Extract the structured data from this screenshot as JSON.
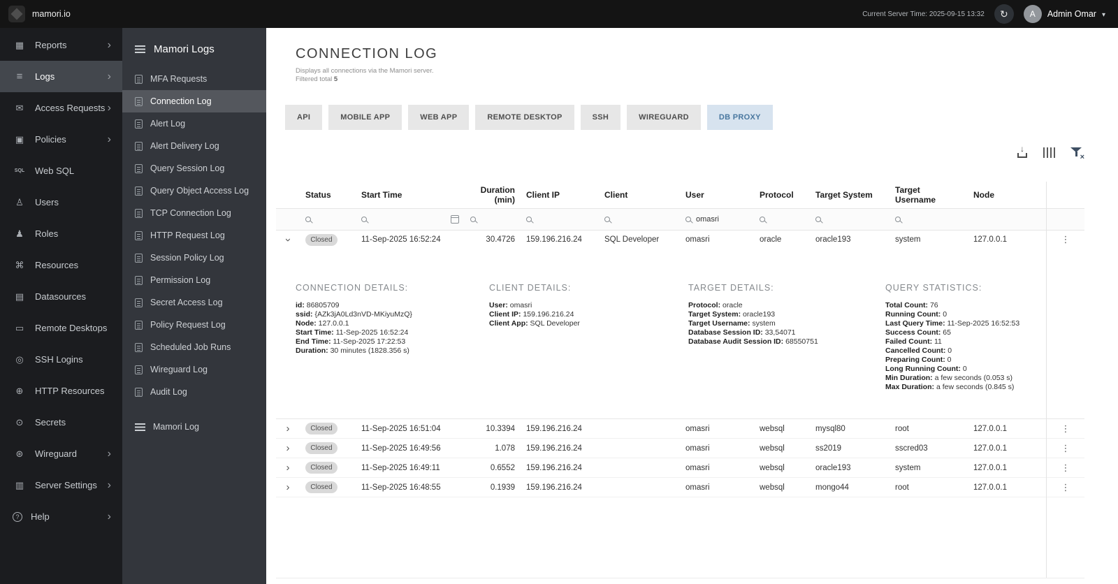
{
  "topbar": {
    "logo_text": "mamori.io",
    "server_time": "Current Server Time: 2025-09-15 13:32",
    "user_name": "Admin Omar",
    "avatar_letter": "A"
  },
  "sidebar": {
    "items": [
      {
        "label": "Reports",
        "icon": "reports-icon",
        "chevron": true,
        "active": false
      },
      {
        "label": "Logs",
        "icon": "logs-icon",
        "chevron": true,
        "active": true
      },
      {
        "label": "Access Requests",
        "icon": "access-requests-icon",
        "chevron": true,
        "active": false
      },
      {
        "label": "Policies",
        "icon": "policies-icon",
        "chevron": true,
        "active": false
      },
      {
        "label": "Web SQL",
        "icon": "web-sql-icon",
        "chevron": false,
        "active": false
      },
      {
        "label": "Users",
        "icon": "users-icon",
        "chevron": false,
        "active": false
      },
      {
        "label": "Roles",
        "icon": "roles-icon",
        "chevron": false,
        "active": false
      },
      {
        "label": "Resources",
        "icon": "resources-icon",
        "chevron": false,
        "active": false
      },
      {
        "label": "Datasources",
        "icon": "datasources-icon",
        "chevron": false,
        "active": false
      },
      {
        "label": "Remote Desktops",
        "icon": "remote-desktops-icon",
        "chevron": false,
        "active": false
      },
      {
        "label": "SSH Logins",
        "icon": "ssh-logins-icon",
        "chevron": false,
        "active": false
      },
      {
        "label": "HTTP Resources",
        "icon": "http-resources-icon",
        "chevron": false,
        "active": false
      },
      {
        "label": "Secrets",
        "icon": "secrets-icon",
        "chevron": false,
        "active": false
      },
      {
        "label": "Wireguard",
        "icon": "wireguard-icon",
        "chevron": true,
        "active": false
      },
      {
        "label": "Server Settings",
        "icon": "server-settings-icon",
        "chevron": true,
        "active": false
      },
      {
        "label": "Help",
        "icon": "help-icon",
        "chevron": true,
        "active": false
      }
    ]
  },
  "subsidebar": {
    "title": "Mamori Logs",
    "items": [
      {
        "label": "MFA Requests",
        "active": false
      },
      {
        "label": "Connection Log",
        "active": true
      },
      {
        "label": "Alert Log",
        "active": false
      },
      {
        "label": "Alert Delivery Log",
        "active": false
      },
      {
        "label": "Query Session Log",
        "active": false
      },
      {
        "label": "Query Object Access Log",
        "active": false
      },
      {
        "label": "TCP Connection Log",
        "active": false
      },
      {
        "label": "HTTP Request Log",
        "active": false
      },
      {
        "label": "Session Policy Log",
        "active": false
      },
      {
        "label": "Permission Log",
        "active": false
      },
      {
        "label": "Secret Access Log",
        "active": false
      },
      {
        "label": "Policy Request Log",
        "active": false
      },
      {
        "label": "Scheduled Job Runs",
        "active": false
      },
      {
        "label": "Wireguard Log",
        "active": false
      },
      {
        "label": "Audit Log",
        "active": false
      }
    ],
    "bottom_item": "Mamori Log"
  },
  "main": {
    "title": "CONNECTION LOG",
    "subtitle": "Displays all connections via the Mamori server.",
    "filtered_label": "Filtered total",
    "filtered_total": "5",
    "tabs": [
      {
        "label": "API",
        "active": false
      },
      {
        "label": "MOBILE APP",
        "active": false
      },
      {
        "label": "WEB APP",
        "active": false
      },
      {
        "label": "REMOTE DESKTOP",
        "active": false
      },
      {
        "label": "SSH",
        "active": false
      },
      {
        "label": "WIREGUARD",
        "active": false
      },
      {
        "label": "DB PROXY",
        "active": true
      }
    ],
    "table": {
      "columns": [
        "Status",
        "Start Time",
        "Duration (min)",
        "Client IP",
        "Client",
        "User",
        "Protocol",
        "Target System",
        "Target Username",
        "Node"
      ],
      "filters": {
        "user": "omasri"
      },
      "expanded_row": {
        "status": "Closed",
        "start_time": "11-Sep-2025 16:52:24",
        "duration": "30.4726",
        "client_ip": "159.196.216.24",
        "client": "SQL Developer",
        "user": "omasri",
        "protocol": "oracle",
        "target_system": "oracle193",
        "target_username": "system",
        "node": "127.0.0.1"
      },
      "rows": [
        {
          "status": "Closed",
          "start_time": "11-Sep-2025 16:51:04",
          "duration": "10.3394",
          "client_ip": "159.196.216.24",
          "client": "",
          "user": "omasri",
          "protocol": "websql",
          "target_system": "mysql80",
          "target_username": "root",
          "node": "127.0.0.1"
        },
        {
          "status": "Closed",
          "start_time": "11-Sep-2025 16:49:56",
          "duration": "1.078",
          "client_ip": "159.196.216.24",
          "client": "",
          "user": "omasri",
          "protocol": "websql",
          "target_system": "ss2019",
          "target_username": "sscred03",
          "node": "127.0.0.1"
        },
        {
          "status": "Closed",
          "start_time": "11-Sep-2025 16:49:11",
          "duration": "0.6552",
          "client_ip": "159.196.216.24",
          "client": "",
          "user": "omasri",
          "protocol": "websql",
          "target_system": "oracle193",
          "target_username": "system",
          "node": "127.0.0.1"
        },
        {
          "status": "Closed",
          "start_time": "11-Sep-2025 16:48:55",
          "duration": "0.1939",
          "client_ip": "159.196.216.24",
          "client": "",
          "user": "omasri",
          "protocol": "websql",
          "target_system": "mongo44",
          "target_username": "root",
          "node": "127.0.0.1"
        }
      ]
    },
    "details": {
      "connection": {
        "heading": "CONNECTION DETAILS:",
        "fields": [
          {
            "label": "id:",
            "value": "86805709"
          },
          {
            "label": "ssid:",
            "value": "{AZk3jA0Ld3nVD-MKiyuMzQ}"
          },
          {
            "label": "Node:",
            "value": "127.0.0.1"
          },
          {
            "label": "Start Time:",
            "value": "11-Sep-2025 16:52:24"
          },
          {
            "label": "End Time:",
            "value": "11-Sep-2025 17:22:53"
          },
          {
            "label": "Duration:",
            "value": "30 minutes (1828.356 s)"
          }
        ]
      },
      "client": {
        "heading": "CLIENT DETAILS:",
        "fields": [
          {
            "label": "User:",
            "value": "omasri"
          },
          {
            "label": "Client IP:",
            "value": "159.196.216.24"
          },
          {
            "label": "Client App:",
            "value": "SQL Developer"
          }
        ]
      },
      "target": {
        "heading": "TARGET DETAILS:",
        "fields": [
          {
            "label": "Protocol:",
            "value": "oracle"
          },
          {
            "label": "Target System:",
            "value": "oracle193"
          },
          {
            "label": "Target Username:",
            "value": "system"
          },
          {
            "label": "Database Session ID:",
            "value": "33,54071"
          },
          {
            "label": "Database Audit Session ID:",
            "value": "68550751"
          }
        ]
      },
      "stats": {
        "heading": "QUERY STATISTICS:",
        "fields": [
          {
            "label": "Total Count:",
            "value": "76"
          },
          {
            "label": "Running Count:",
            "value": "0"
          },
          {
            "label": "Last Query Time:",
            "value": "11-Sep-2025 16:52:53"
          },
          {
            "label": "Success Count:",
            "value": "65"
          },
          {
            "label": "Failed Count:",
            "value": "11"
          },
          {
            "label": "Cancelled Count:",
            "value": "0"
          },
          {
            "label": "Preparing Count:",
            "value": "0"
          },
          {
            "label": "Long Running Count:",
            "value": "0"
          },
          {
            "label": "Min Duration:",
            "value": "a few seconds (0.053 s)"
          },
          {
            "label": "Max Duration:",
            "value": "a few seconds (0.845 s)"
          }
        ]
      }
    }
  }
}
